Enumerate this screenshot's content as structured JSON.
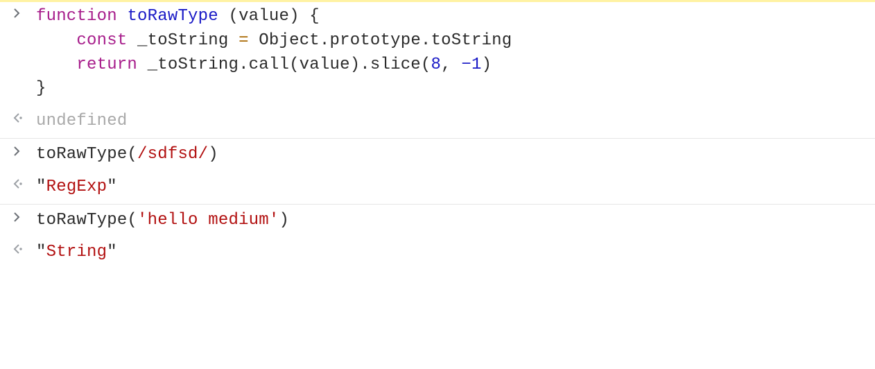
{
  "rows": [
    {
      "dir": "in",
      "cls": "first",
      "segments": [
        {
          "cls": "kw",
          "t": "function"
        },
        {
          "t": " "
        },
        {
          "cls": "fn",
          "t": "toRawType"
        },
        {
          "t": " (value) {\n"
        },
        {
          "t": "    "
        },
        {
          "cls": "kw",
          "t": "const"
        },
        {
          "t": " _toString "
        },
        {
          "cls": "as",
          "t": "="
        },
        {
          "t": " Object.prototype.toString\n"
        },
        {
          "t": "    "
        },
        {
          "cls": "kw",
          "t": "return"
        },
        {
          "t": " _toString.call(value).slice("
        },
        {
          "cls": "nm",
          "t": "8"
        },
        {
          "t": ", "
        },
        {
          "cls": "nm",
          "t": "−"
        },
        {
          "cls": "nm",
          "t": "1"
        },
        {
          "t": ")\n"
        },
        {
          "t": "}"
        }
      ]
    },
    {
      "dir": "out",
      "cls": "out1",
      "segments": [
        {
          "t": "undefined"
        }
      ]
    },
    {
      "dir": "in",
      "cls": "sep",
      "segments": [
        {
          "t": "toRawType("
        },
        {
          "cls": "rx",
          "t": "/sdfsd/"
        },
        {
          "t": ")"
        }
      ]
    },
    {
      "dir": "out",
      "segments": [
        {
          "t": "\""
        },
        {
          "cls": "str",
          "t": "RegExp"
        },
        {
          "t": "\""
        }
      ]
    },
    {
      "dir": "in",
      "cls": "sep",
      "segments": [
        {
          "t": "toRawType("
        },
        {
          "cls": "str",
          "t": "'hello medium'"
        },
        {
          "t": ")"
        }
      ]
    },
    {
      "dir": "out",
      "segments": [
        {
          "t": "\""
        },
        {
          "cls": "str",
          "t": "String"
        },
        {
          "t": "\""
        }
      ]
    }
  ],
  "chart_data": {
    "type": "table",
    "title": "JavaScript Console Session",
    "rows": [
      {
        "direction": "input",
        "code": "function toRawType (value) {\n    const _toString = Object.prototype.toString\n    return _toString.call(value).slice(8, -1)\n}"
      },
      {
        "direction": "output",
        "value": "undefined"
      },
      {
        "direction": "input",
        "code": "toRawType(/sdfsd/)"
      },
      {
        "direction": "output",
        "value": "\"RegExp\""
      },
      {
        "direction": "input",
        "code": "toRawType('hello medium')"
      },
      {
        "direction": "output",
        "value": "\"String\""
      }
    ]
  },
  "icons": {
    "in": "console-input-icon",
    "out": "console-output-icon"
  }
}
